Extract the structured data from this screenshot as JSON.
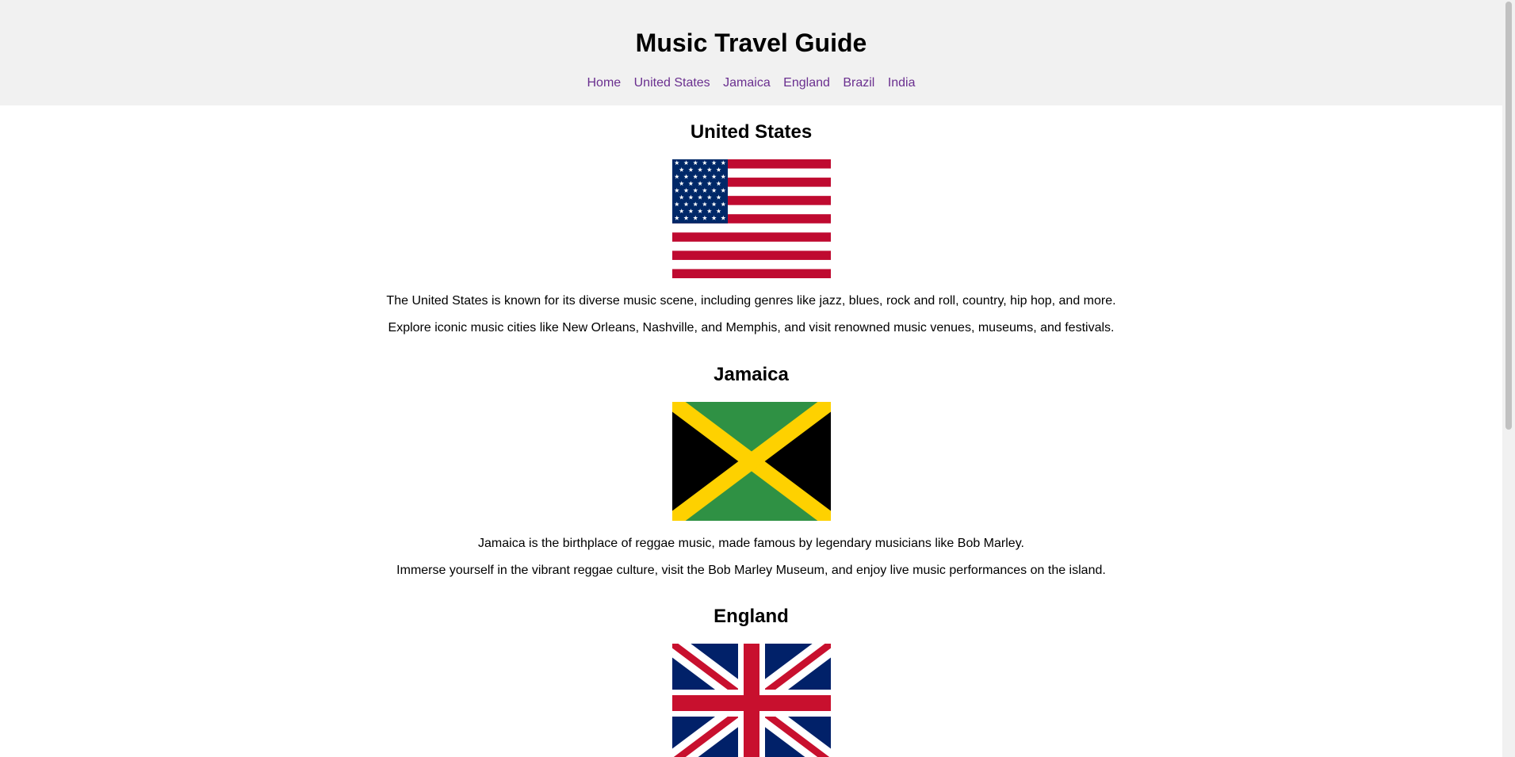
{
  "header": {
    "title": "Music Travel Guide",
    "nav": [
      "Home",
      "United States",
      "Jamaica",
      "England",
      "Brazil",
      "India"
    ]
  },
  "sections": [
    {
      "heading": "United States",
      "flag_icon": "us-flag",
      "paragraphs": [
        "The United States is known for its diverse music scene, including genres like jazz, blues, rock and roll, country, hip hop, and more.",
        "Explore iconic music cities like New Orleans, Nashville, and Memphis, and visit renowned music venues, museums, and festivals."
      ]
    },
    {
      "heading": "Jamaica",
      "flag_icon": "jamaica-flag",
      "paragraphs": [
        "Jamaica is the birthplace of reggae music, made famous by legendary musicians like Bob Marley.",
        "Immerse yourself in the vibrant reggae culture, visit the Bob Marley Museum, and enjoy live music performances on the island."
      ]
    },
    {
      "heading": "England",
      "flag_icon": "uk-flag",
      "paragraphs": []
    }
  ],
  "colors": {
    "header_bg": "#f1f1f1",
    "nav_link": "#6a2f8f",
    "us_red": "#bf0a30",
    "us_blue": "#002868",
    "jm_green": "#2f9144",
    "jm_gold": "#fed100",
    "uk_blue": "#012169",
    "uk_red": "#c8102e"
  }
}
